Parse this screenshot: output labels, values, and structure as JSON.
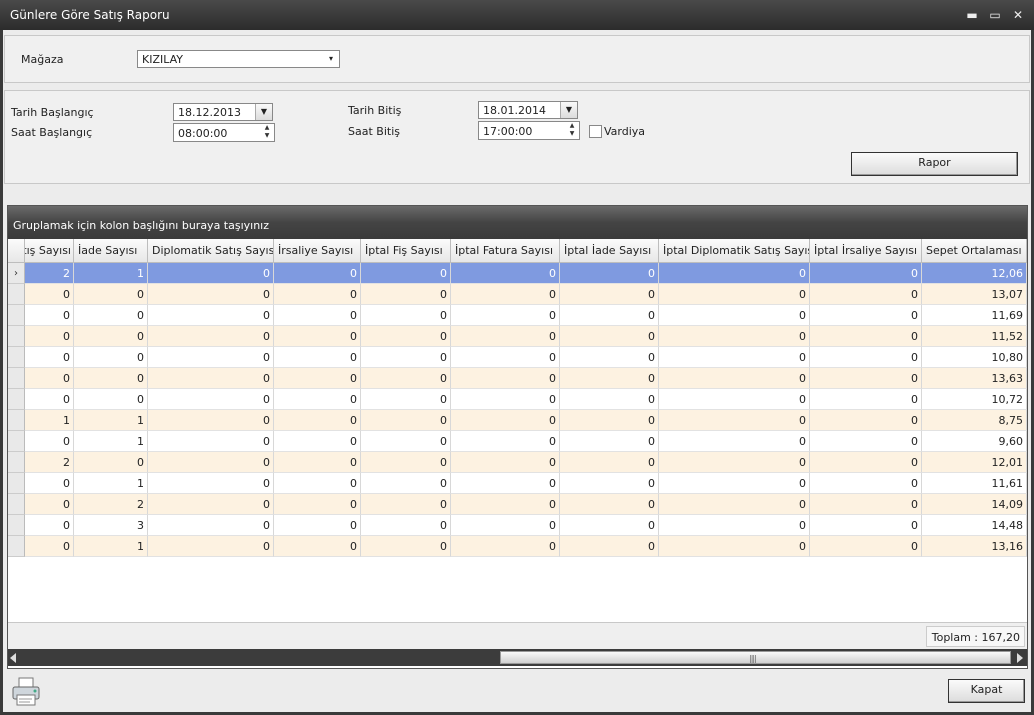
{
  "window": {
    "title": "Günlere Göre Satış Raporu",
    "minimize": "▬",
    "maximize": "▭",
    "close": "✕"
  },
  "store": {
    "label": "Mağaza",
    "value": "KIZILAY"
  },
  "filters": {
    "start_date_label": "Tarih Başlangıç",
    "start_date": "18.12.2013",
    "start_time_label": "Saat Başlangıç",
    "start_time": "08:00:00",
    "end_date_label": "Tarih Bitiş",
    "end_date": "18.01.2014",
    "end_time_label": "Saat Bitiş",
    "end_time": "17:00:00",
    "shift_label": "Vardiya",
    "shift_checked": false
  },
  "report_button": "Rapor",
  "grid": {
    "group_hint": "Gruplamak için kolon başlığını buraya taşıyınız",
    "columns": [
      "Satış Sayısı",
      "İade Sayısı",
      "Diplomatik Satış Sayısı",
      "İrsaliye Sayısı",
      "İptal Fiş Sayısı",
      "İptal Fatura Sayısı",
      "İptal İade Sayısı",
      "İptal Diplomatik Satış Sayısı",
      "İptal İrsaliye Sayısı",
      "Sepet Ortalaması"
    ],
    "rows": [
      [
        "2",
        "1",
        "0",
        "0",
        "0",
        "0",
        "0",
        "0",
        "0",
        "12,06"
      ],
      [
        "0",
        "0",
        "0",
        "0",
        "0",
        "0",
        "0",
        "0",
        "0",
        "13,07"
      ],
      [
        "0",
        "0",
        "0",
        "0",
        "0",
        "0",
        "0",
        "0",
        "0",
        "11,69"
      ],
      [
        "0",
        "0",
        "0",
        "0",
        "0",
        "0",
        "0",
        "0",
        "0",
        "11,52"
      ],
      [
        "0",
        "0",
        "0",
        "0",
        "0",
        "0",
        "0",
        "0",
        "0",
        "10,80"
      ],
      [
        "0",
        "0",
        "0",
        "0",
        "0",
        "0",
        "0",
        "0",
        "0",
        "13,63"
      ],
      [
        "0",
        "0",
        "0",
        "0",
        "0",
        "0",
        "0",
        "0",
        "0",
        "10,72"
      ],
      [
        "1",
        "1",
        "0",
        "0",
        "0",
        "0",
        "0",
        "0",
        "0",
        "8,75"
      ],
      [
        "0",
        "1",
        "0",
        "0",
        "0",
        "0",
        "0",
        "0",
        "0",
        "9,60"
      ],
      [
        "2",
        "0",
        "0",
        "0",
        "0",
        "0",
        "0",
        "0",
        "0",
        "12,01"
      ],
      [
        "0",
        "1",
        "0",
        "0",
        "0",
        "0",
        "0",
        "0",
        "0",
        "11,61"
      ],
      [
        "0",
        "2",
        "0",
        "0",
        "0",
        "0",
        "0",
        "0",
        "0",
        "14,09"
      ],
      [
        "0",
        "3",
        "0",
        "0",
        "0",
        "0",
        "0",
        "0",
        "0",
        "14,48"
      ],
      [
        "0",
        "1",
        "0",
        "0",
        "0",
        "0",
        "0",
        "0",
        "0",
        "13,16"
      ]
    ],
    "selected_row": 0,
    "total": "Toplam : 167,20"
  },
  "close_button": "Kapat",
  "icons": {
    "printer": "printer-icon",
    "row_indicator": "chevron-right-icon"
  }
}
